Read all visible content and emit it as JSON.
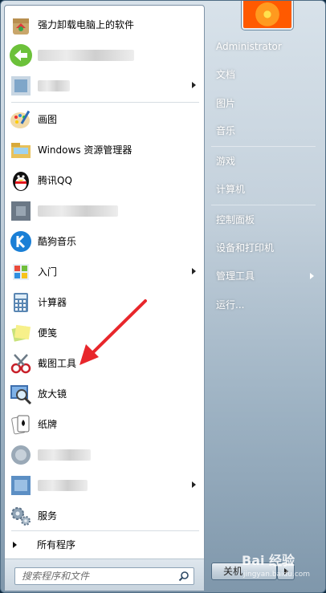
{
  "programs": [
    {
      "label": "强力卸载电脑上的软件",
      "icon": "uninstall-icon"
    },
    {
      "label": "",
      "icon": "green-app-icon",
      "blurred": true
    },
    {
      "label": "",
      "icon": "blue-app-icon",
      "blurred": true,
      "submenu": true
    },
    {
      "label": "画图",
      "icon": "paint-palette-icon"
    },
    {
      "label": "Windows 资源管理器",
      "icon": "folder-explorer-icon"
    },
    {
      "label": "腾讯QQ",
      "icon": "qq-penguin-icon"
    },
    {
      "label": "",
      "icon": "dark-app-icon",
      "blurred": true
    },
    {
      "label": "酷狗音乐",
      "icon": "kugou-k-icon"
    },
    {
      "label": "入门",
      "icon": "getting-started-icon",
      "submenu": true
    },
    {
      "label": "计算器",
      "icon": "calculator-icon"
    },
    {
      "label": "便笺",
      "icon": "sticky-notes-icon"
    },
    {
      "label": "截图工具",
      "icon": "scissors-icon"
    },
    {
      "label": "放大镜",
      "icon": "magnifier-icon"
    },
    {
      "label": "纸牌",
      "icon": "playing-cards-icon"
    },
    {
      "label": "",
      "icon": "globe-app-icon",
      "blurred": true
    },
    {
      "label": "",
      "icon": "blue-app-icon-2",
      "blurred": true,
      "submenu": true
    },
    {
      "label": "服务",
      "icon": "gears-icon"
    }
  ],
  "all_programs": "所有程序",
  "search": {
    "placeholder": "搜索程序和文件"
  },
  "right": {
    "user": "Administrator",
    "items": [
      "文档",
      "图片",
      "音乐",
      "游戏",
      "计算机",
      "控制面板",
      "设备和打印机",
      "管理工具",
      "运行..."
    ]
  },
  "shutdown": {
    "label": "关机"
  },
  "watermark": {
    "text": "Bai 经验",
    "sub": "jingyan.baidu.com"
  },
  "colors": {
    "annotation_arrow": "#e8262b"
  }
}
